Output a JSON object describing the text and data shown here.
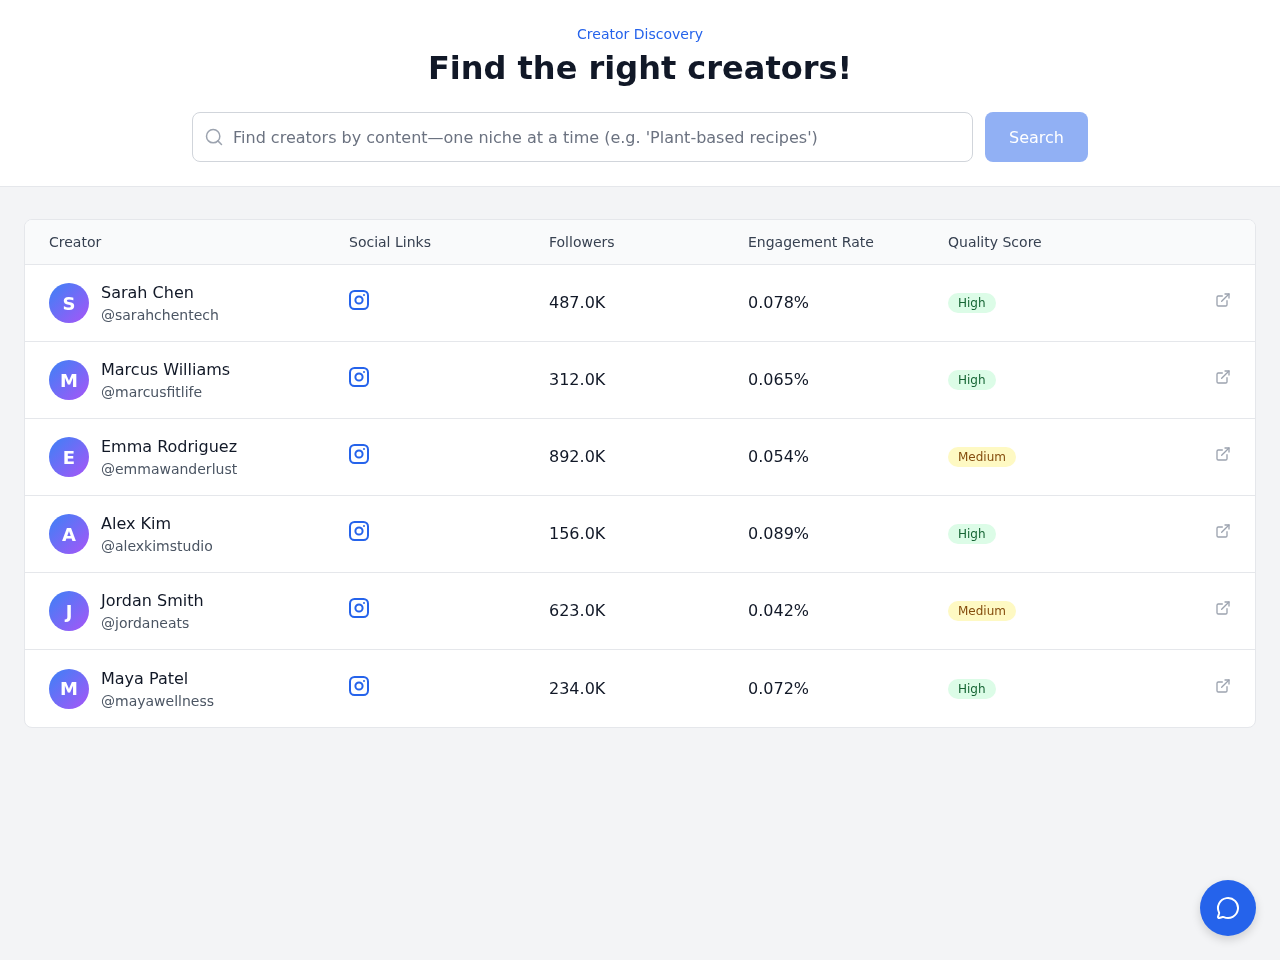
{
  "header": {
    "eyebrow": "Creator Discovery",
    "title": "Find the right creators!",
    "search": {
      "placeholder": "Find creators by content—one niche at a time (e.g. 'Plant-based recipes')",
      "button": {
        "label": "Search",
        "disabled": true
      }
    }
  },
  "table": {
    "columns": [
      "Creator",
      "Social Links",
      "Followers",
      "Engagement Rate",
      "Quality Score"
    ],
    "rows": [
      {
        "initial": "S",
        "name": "Sarah Chen",
        "handle": "@sarahchentech",
        "followers": "487.0K",
        "engagement": "0.078%",
        "quality": {
          "label": "High",
          "kind": "high"
        }
      },
      {
        "initial": "M",
        "name": "Marcus Williams",
        "handle": "@marcusfitlife",
        "followers": "312.0K",
        "engagement": "0.065%",
        "quality": {
          "label": "High",
          "kind": "high"
        }
      },
      {
        "initial": "E",
        "name": "Emma Rodriguez",
        "handle": "@emmawanderlust",
        "followers": "892.0K",
        "engagement": "0.054%",
        "quality": {
          "label": "Medium",
          "kind": "medium"
        }
      },
      {
        "initial": "A",
        "name": "Alex Kim",
        "handle": "@alexkimstudio",
        "followers": "156.0K",
        "engagement": "0.089%",
        "quality": {
          "label": "High",
          "kind": "high"
        }
      },
      {
        "initial": "J",
        "name": "Jordan Smith",
        "handle": "@jordaneats",
        "followers": "623.0K",
        "engagement": "0.042%",
        "quality": {
          "label": "Medium",
          "kind": "medium"
        }
      },
      {
        "initial": "M",
        "name": "Maya Patel",
        "handle": "@mayawellness",
        "followers": "234.0K",
        "engagement": "0.072%",
        "quality": {
          "label": "High",
          "kind": "high"
        }
      }
    ]
  }
}
